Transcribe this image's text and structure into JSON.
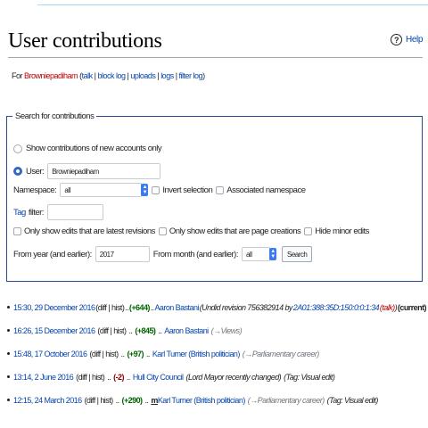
{
  "page": {
    "title": "User contributions",
    "help_label": "Help"
  },
  "for_line": {
    "prefix": "For",
    "user": "Browniepadiham",
    "talk": "talk",
    "block_log": "block log",
    "uploads": "uploads",
    "logs": "logs",
    "filter_log": "filter log"
  },
  "search": {
    "legend": "Search for contributions",
    "new_accounts_label": "Show contributions of new accounts only",
    "user_label": "User:",
    "user_value": "Browniepadiham",
    "namespace_label": "Namespace:",
    "namespace_value": "all",
    "invert_label": "Invert selection",
    "associated_label": "Associated namespace",
    "tag_filter_label": "Tag",
    "tag_filter_suffix": "filter:",
    "latest_label": "Only show edits that are latest revisions",
    "creations_label": "Only show edits that are page creations",
    "hide_minor_label": "Hide minor edits",
    "year_label": "From year (and earlier):",
    "year_value": "2017",
    "month_label": "From month (and earlier):",
    "month_value": "all",
    "search_button": "Search"
  },
  "contributions": [
    {
      "timestamp": "15:30, 29 December 2016",
      "diff_hist": "(diff | hist)",
      "sep": "..",
      "size": "(+644)",
      "size_sign": "pos",
      "sep2": "..",
      "minor": "",
      "page": "Aaron Bastani",
      "comment": "(Undid revision 756382914 by",
      "comment_link": "2A01:388:35D:150:0:0:1:34",
      "comment_talk": "(talk)",
      "comment_close": ")",
      "tags": "",
      "current": "(current)"
    },
    {
      "timestamp": "16:26, 15 December 2016",
      "diff_hist": "(diff | hist)",
      "sep": "..",
      "size": "(+845)",
      "size_sign": "pos",
      "sep2": "..",
      "minor": "",
      "page": "Aaron Bastani",
      "comment": "(→Views)",
      "comment_link": "",
      "comment_talk": "",
      "comment_close": "",
      "tags": "",
      "current": ""
    },
    {
      "timestamp": "15:48, 17 October 2016",
      "diff_hist": "(diff | hist)",
      "sep": "..",
      "size": "(+97)",
      "size_sign": "pos",
      "sep2": "..",
      "minor": "",
      "page": "Karl Turner (British politician)",
      "comment": "(→Parliamentary career)",
      "comment_link": "",
      "comment_talk": "",
      "comment_close": "",
      "tags": "",
      "current": ""
    },
    {
      "timestamp": "13:14, 2 June 2016",
      "diff_hist": "(diff | hist)",
      "sep": "..",
      "size": "(-2)",
      "size_sign": "neg",
      "sep2": "..",
      "minor": "",
      "page": "Hull City Council",
      "comment": "(Lord Mayor recently changed)",
      "comment_link": "",
      "comment_talk": "",
      "comment_close": "",
      "tags": "(Tag: Visual edit)",
      "current": ""
    },
    {
      "timestamp": "12:15, 24 March 2016",
      "diff_hist": "(diff | hist)",
      "sep": "..",
      "size": "(+290)",
      "size_sign": "pos",
      "sep2": "..",
      "minor": "m",
      "page": "Karl Turner (British politician)",
      "comment": "(→Parliamentary career)",
      "comment_link": "",
      "comment_talk": "",
      "comment_close": "",
      "tags": "(Tag: Visual edit)",
      "current": ""
    }
  ]
}
